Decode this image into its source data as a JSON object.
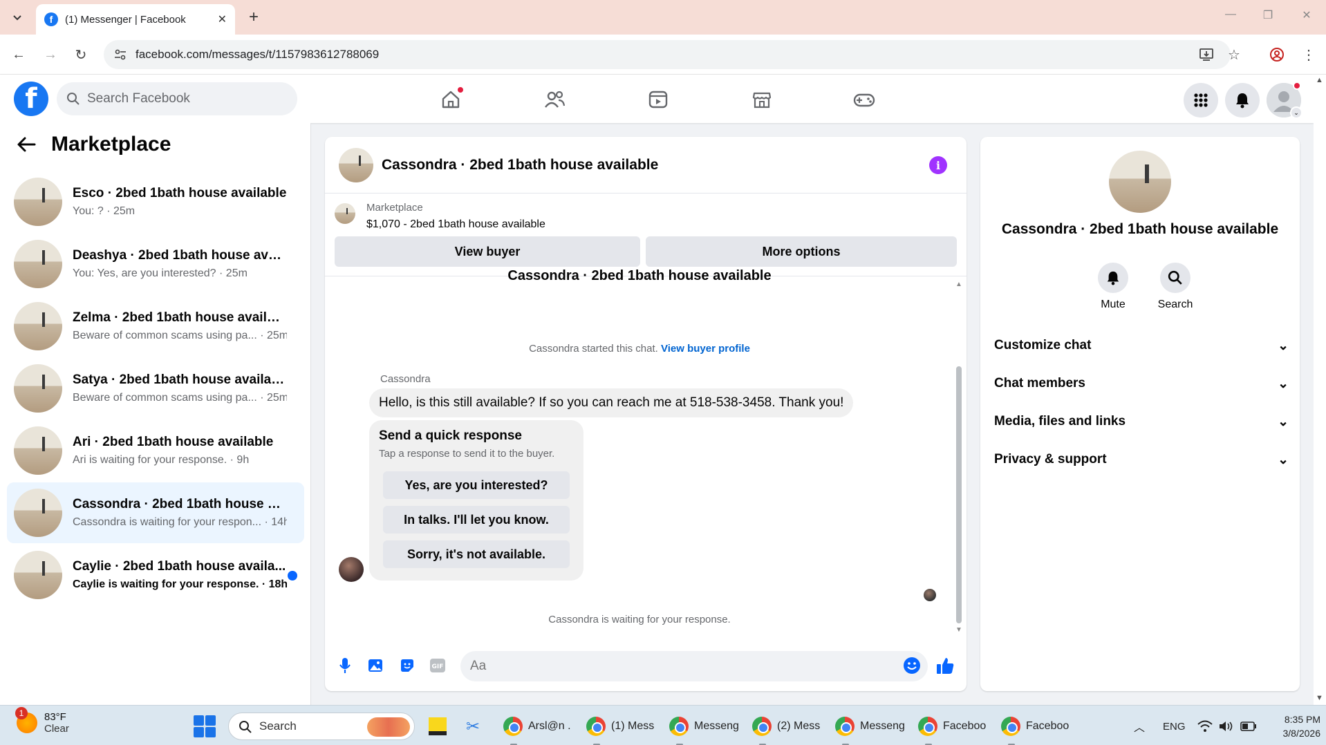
{
  "browser": {
    "tab_title": "(1) Messenger | Facebook",
    "tab_close": "✕",
    "new_tab": "+",
    "url": "facebook.com/messages/t/1157983612788069"
  },
  "fb": {
    "logo_letter": "f",
    "search_placeholder": "Search Facebook"
  },
  "left": {
    "title": "Marketplace",
    "conversations": [
      {
        "name": "Esco · 2bed 1bath house available",
        "sub": "You: ? · 25m",
        "unread": false,
        "selected": false
      },
      {
        "name": "Deashya · 2bed 1bath house availa...",
        "sub": "You: Yes, are you interested? · 25m",
        "unread": false,
        "selected": false
      },
      {
        "name": "Zelma · 2bed 1bath house available",
        "sub": "Beware of common scams using pa... · 25m",
        "unread": false,
        "selected": false
      },
      {
        "name": "Satya · 2bed 1bath house available",
        "sub": "Beware of common scams using pa... · 25m",
        "unread": false,
        "selected": false
      },
      {
        "name": "Ari · 2bed 1bath house available",
        "sub": "Ari is waiting for your response. · 9h",
        "unread": false,
        "selected": false
      },
      {
        "name": "Cassondra · 2bed 1bath house avai...",
        "sub": "Cassondra is waiting for your respon... · 14h",
        "unread": false,
        "selected": true
      },
      {
        "name": "Caylie · 2bed 1bath house availa...",
        "sub": "Caylie is waiting for your response. · 18h",
        "unread": true,
        "selected": false
      }
    ]
  },
  "chat": {
    "title": "Cassondra · 2bed 1bath house available",
    "info_glyph": "i",
    "listing_source": "Marketplace",
    "listing_title": "$1,070 - 2bed 1bath house available",
    "view_buyer": "View buyer",
    "more_options": "More options",
    "cut_title": "Cassondra · 2bed 1bath house available",
    "started_text": "Cassondra started this chat.",
    "view_buyer_profile": "View buyer profile",
    "sender_name": "Cassondra",
    "message": "Hello, is this still available? If so you can reach me at 518-538-3458. Thank you!",
    "quick_title": "Send a quick response",
    "quick_sub": "Tap a response to send it to the buyer.",
    "quick_responses": [
      "Yes, are you interested?",
      "In talks. I'll let you know.",
      "Sorry, it's not available."
    ],
    "waiting": "Cassondra is waiting for your response.",
    "input_placeholder": "Aa"
  },
  "info": {
    "name": "Cassondra · 2bed 1bath house available",
    "mute": "Mute",
    "search": "Search",
    "rows": [
      "Customize chat",
      "Chat members",
      "Media, files and links",
      "Privacy & support"
    ]
  },
  "taskbar": {
    "weather_badge": "1",
    "temp": "83°F",
    "condition": "Clear",
    "search": "Search",
    "apps": [
      "Arsl@n .",
      "(1) Mess",
      "Messeng",
      "(2) Mess",
      "Messeng",
      "Faceboo",
      "Faceboo"
    ],
    "lang": "ENG",
    "time": "8:35 PM",
    "date": "3/8/2026"
  },
  "colors": {
    "brand": "#1877f2",
    "link": "#0064d1",
    "selected_bg": "#ebf5ff",
    "info_purple": "#a033ff",
    "unread_dot": "#0866ff"
  }
}
